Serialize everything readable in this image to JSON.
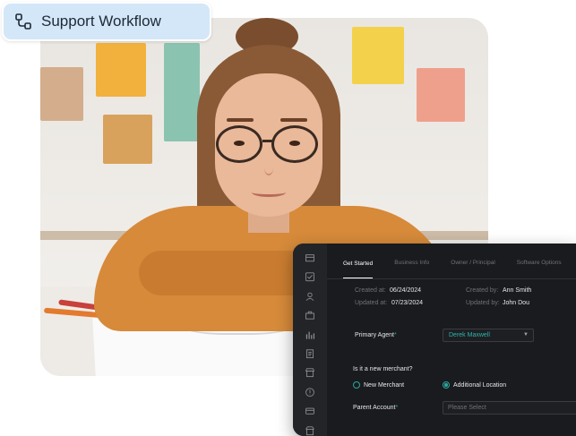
{
  "badge": {
    "label": "Support Workflow",
    "icon": "workflow-icon"
  },
  "colors": {
    "badge_bg": "#d3e7f8",
    "panel_bg": "#1a1b1e",
    "accent": "#2aa7a0"
  },
  "tabs": [
    "Get Started",
    "Business Info",
    "Owner / Principal",
    "Software Options"
  ],
  "meta": {
    "created_at_label": "Created at:",
    "created_at": "06/24/2024",
    "updated_at_label": "Updated at:",
    "updated_at": "07/23/2024",
    "created_by_label": "Created by:",
    "created_by": "Ann Smith",
    "updated_by_label": "Updated by:",
    "updated_by": "John Dou"
  },
  "form": {
    "primary_agent_label": "Primary Agent",
    "primary_agent_value": "Derek Maxwell",
    "new_merchant_question": "Is it a new merchant?",
    "option_new": "New Merchant",
    "option_additional": "Additional Location",
    "selected_option": "Additional Location",
    "parent_account_label": "Parent Account",
    "parent_account_placeholder": "Please Select",
    "required_mark": "*"
  },
  "rail_icons": [
    "store-icon",
    "checklist-icon",
    "user-icon",
    "briefcase-icon",
    "bar-chart-icon",
    "document-icon",
    "shop-icon",
    "alert-icon",
    "card-icon",
    "storefront-icon"
  ]
}
